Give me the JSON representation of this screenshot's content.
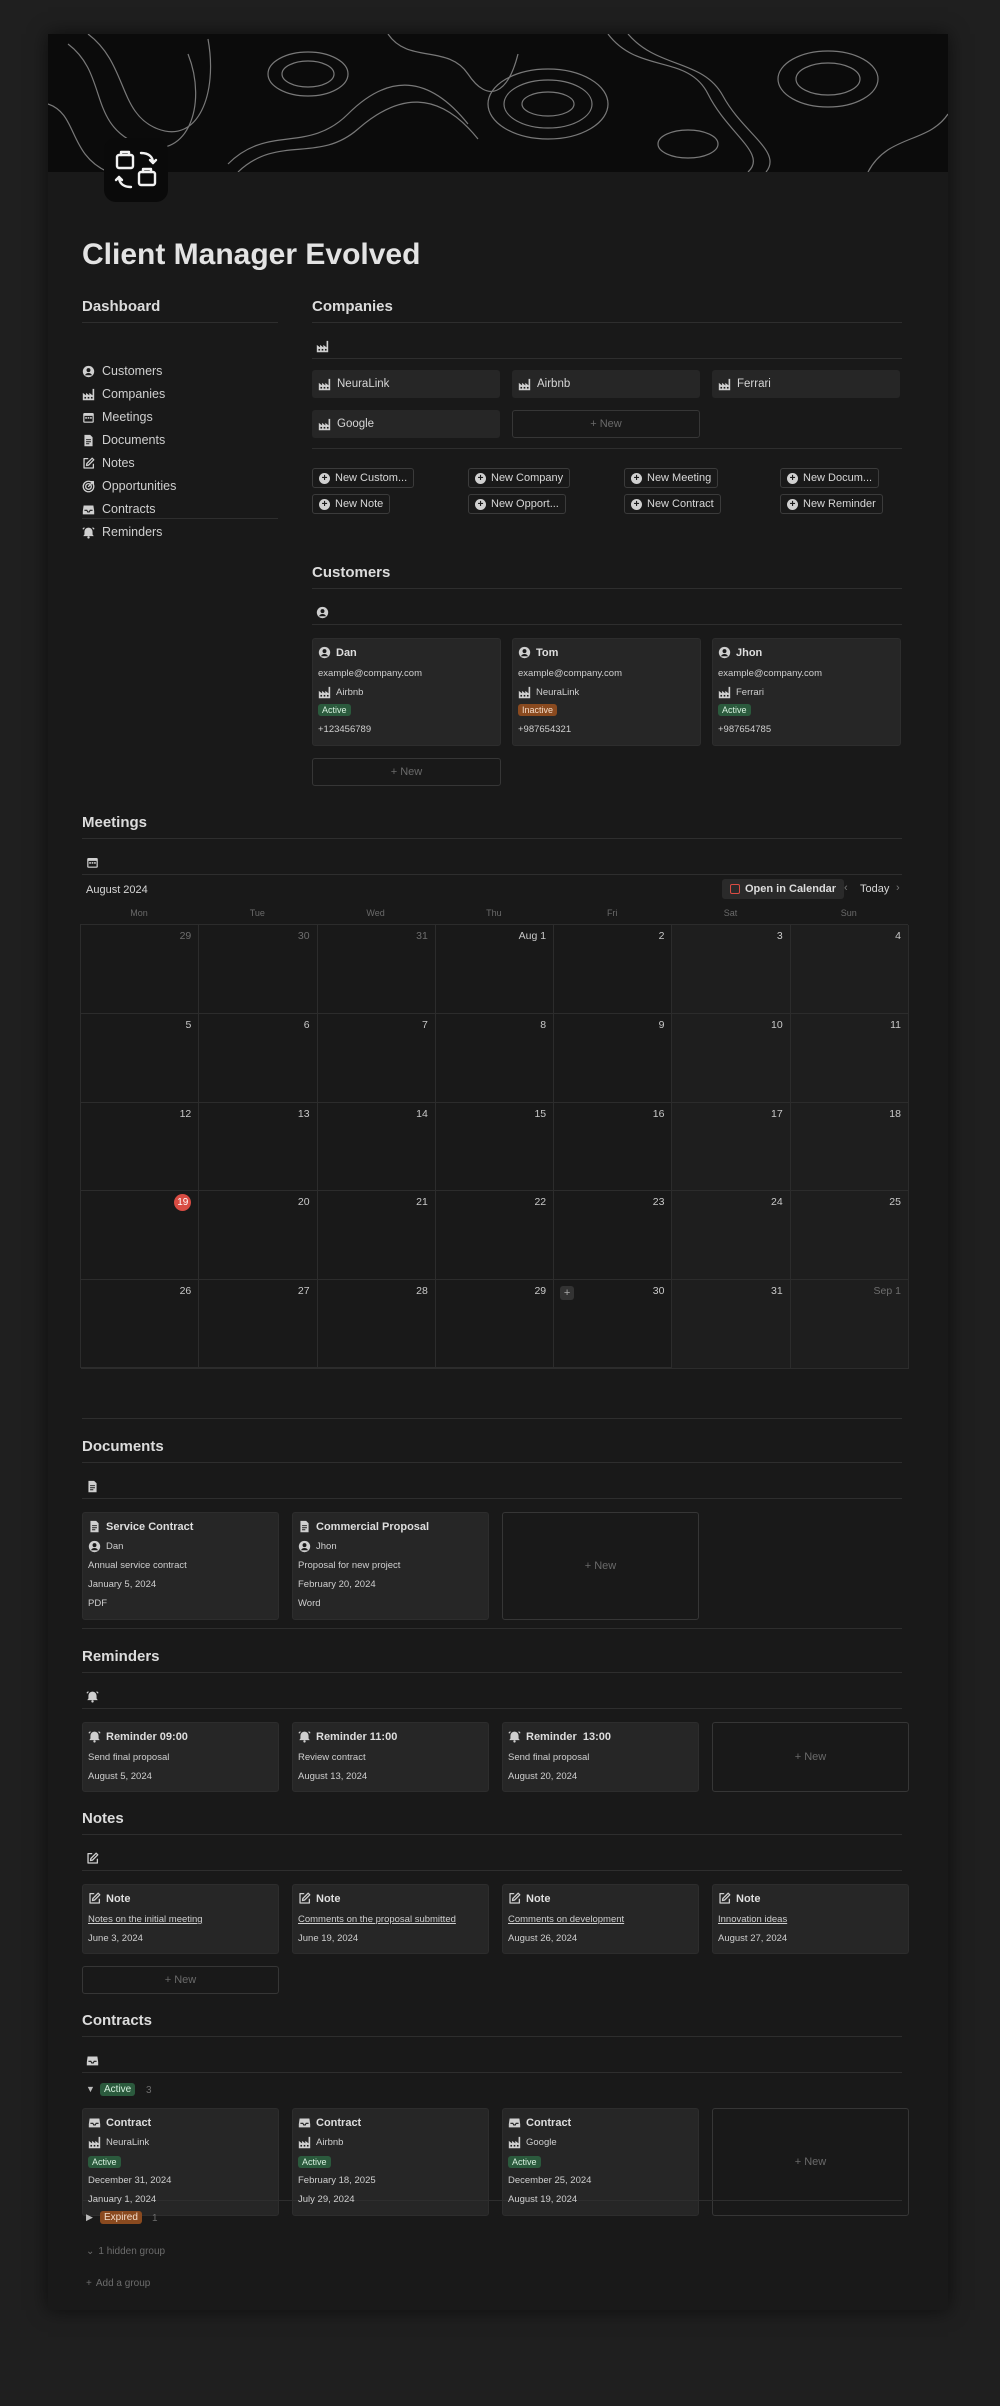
{
  "page": {
    "title": "Client Manager Evolved"
  },
  "dashboard": {
    "heading": "Dashboard",
    "items": [
      {
        "label": "Customers",
        "icon": "person-circle-icon"
      },
      {
        "label": "Companies",
        "icon": "factory-icon"
      },
      {
        "label": "Meetings",
        "icon": "calendar-icon"
      },
      {
        "label": "Documents",
        "icon": "document-icon"
      },
      {
        "label": "Notes",
        "icon": "edit-note-icon"
      },
      {
        "label": "Opportunities",
        "icon": "target-icon"
      },
      {
        "label": "Contracts",
        "icon": "inbox-icon"
      },
      {
        "label": "Reminders",
        "icon": "alarm-icon"
      }
    ]
  },
  "companies": {
    "heading": "Companies",
    "tiles": [
      "NeuraLink",
      "Airbnb",
      "Ferrari",
      "Google"
    ],
    "new_label": "New"
  },
  "quick_actions": [
    "New Custom...",
    "New Company",
    "New Meeting",
    "New Docum...",
    "New Note",
    "New Opport...",
    "New Contract",
    "New Reminder"
  ],
  "customers": {
    "heading": "Customers",
    "cards": [
      {
        "name": "Dan",
        "email": "example@company.com",
        "company": "Airbnb",
        "status": "Active",
        "phone": "+123456789"
      },
      {
        "name": "Tom",
        "email": "example@company.com",
        "company": "NeuraLink",
        "status": "Inactive",
        "phone": "+987654321"
      },
      {
        "name": "Jhon",
        "email": "example@company.com",
        "company": "Ferrari",
        "status": "Active",
        "phone": "+987654785"
      }
    ],
    "new_label": "New"
  },
  "meetings": {
    "heading": "Meetings",
    "month": "August 2024",
    "open_calendar": "Open in Calendar",
    "today_label": "Today",
    "days": [
      "Mon",
      "Tue",
      "Wed",
      "Thu",
      "Fri",
      "Sat",
      "Sun"
    ],
    "weeks": [
      [
        "29",
        "30",
        "31",
        "Aug 1",
        "2",
        "3",
        "4"
      ],
      [
        "5",
        "6",
        "7",
        "8",
        "9",
        "10",
        "11"
      ],
      [
        "12",
        "13",
        "14",
        "15",
        "16",
        "17",
        "18"
      ],
      [
        "19",
        "20",
        "21",
        "22",
        "23",
        "24",
        "25"
      ],
      [
        "26",
        "27",
        "28",
        "29",
        "30",
        "31",
        "Sep 1"
      ]
    ],
    "today": "19"
  },
  "documents": {
    "heading": "Documents",
    "cards": [
      {
        "title": "Service Contract",
        "person": "Dan",
        "description": "Annual service contract",
        "date": "January 5, 2024",
        "type": "PDF"
      },
      {
        "title": "Commercial Proposal",
        "person": "Jhon",
        "description": "Proposal for new project",
        "date": "February 20, 2024",
        "type": "Word"
      }
    ],
    "new_label": "New"
  },
  "reminders": {
    "heading": "Reminders",
    "cards": [
      {
        "title": "Reminder 09:00",
        "text": "Send final proposal",
        "date": "August 5, 2024"
      },
      {
        "title": "Reminder 11:00",
        "text": "Review contract",
        "date": "August 13, 2024"
      },
      {
        "title": "Reminder  13:00",
        "text": "Send final proposal",
        "date": "August 20, 2024"
      }
    ],
    "new_label": "New"
  },
  "notes": {
    "heading": "Notes",
    "cards": [
      {
        "title": "Note",
        "link": "Notes on the initial meeting",
        "date": "June 3, 2024"
      },
      {
        "title": "Note",
        "link": "Comments on the proposal submitted",
        "date": "June 19, 2024"
      },
      {
        "title": "Note",
        "link": "Comments on development",
        "date": "August 26, 2024"
      },
      {
        "title": "Note",
        "link": "Innovation ideas",
        "date": "August 27, 2024"
      }
    ],
    "new_label": "New"
  },
  "contracts": {
    "heading": "Contracts",
    "active_group": {
      "label": "Active",
      "count": "3"
    },
    "cards": [
      {
        "title": "Contract",
        "company": "NeuraLink",
        "status": "Active",
        "end_date": "December 31, 2024",
        "start_date": "January 1, 2024"
      },
      {
        "title": "Contract",
        "company": "Airbnb",
        "status": "Active",
        "end_date": "February 18, 2025",
        "start_date": "July 29, 2024"
      },
      {
        "title": "Contract",
        "company": "Google",
        "status": "Active",
        "end_date": "December 25, 2024",
        "start_date": "August 19, 2024"
      }
    ],
    "new_label": "New",
    "expired_group": {
      "label": "Expired",
      "count": "1"
    },
    "hidden_group": "1 hidden group",
    "add_group": "Add a group"
  },
  "colors": {
    "active": "#2b5a3d",
    "inactive": "#8a4a1f",
    "today": "#d94c43",
    "page": "#191919"
  }
}
